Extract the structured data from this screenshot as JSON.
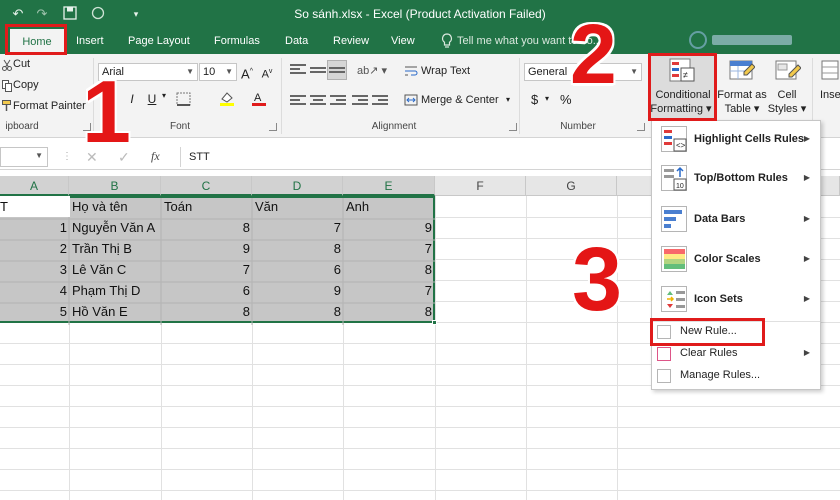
{
  "window": {
    "title": "So sánh.xlsx - Excel (Product Activation Failed)"
  },
  "qat": {
    "undo_icon": "undo-icon",
    "redo_icon": "redo-icon",
    "autosave_icon": "circle-icon",
    "customize_icon": "chevron-down-icon"
  },
  "tabs": [
    "Home",
    "Insert",
    "Page Layout",
    "Formulas",
    "Data",
    "Review",
    "View"
  ],
  "tell_me": "Tell me what you want to do...",
  "clipboard": {
    "cut": "Cut",
    "copy": "Copy",
    "format_painter": "Format Painter",
    "group": "ipboard"
  },
  "font": {
    "name": "Arial",
    "size": "10",
    "bold": "B",
    "italic": "I",
    "underline": "U",
    "group": "Font"
  },
  "alignment": {
    "wrap_text": "Wrap Text",
    "merge_center": "Merge & Center",
    "group": "Alignment"
  },
  "number": {
    "format": "General",
    "currency": "$",
    "percent": "%",
    "group": "Number"
  },
  "styles": {
    "conditional_formatting": [
      "Conditional",
      "Formatting"
    ],
    "format_as_table": [
      "Format as",
      "Table"
    ],
    "cell_styles": [
      "Cell",
      "Styles"
    ],
    "insert": "Inse"
  },
  "formula_bar": {
    "fx": "fx",
    "value": "STT"
  },
  "columns": [
    "A",
    "B",
    "C",
    "D",
    "E",
    "F",
    "G"
  ],
  "sheet": {
    "header_row": [
      "T",
      "Họ và tên",
      "Toán",
      "Văn",
      "Anh"
    ],
    "rows": [
      [
        "1",
        "Nguyễn Văn A",
        "8",
        "7",
        "9"
      ],
      [
        "2",
        "Trần Thị B",
        "9",
        "8",
        "7"
      ],
      [
        "3",
        "Lê Văn C",
        "7",
        "6",
        "8"
      ],
      [
        "4",
        "Phạm Thị D",
        "6",
        "9",
        "7"
      ],
      [
        "5",
        "Hồ Văn E",
        "8",
        "8",
        "8"
      ]
    ]
  },
  "cf_menu": {
    "highlight": "Highlight Cells Rules",
    "topbottom": "Top/Bottom Rules",
    "databars": "Data Bars",
    "colorscales": "Color Scales",
    "iconsets": "Icon Sets",
    "newrule": "New Rule...",
    "clearrules": "Clear Rules",
    "managerules": "Manage Rules..."
  },
  "annotations": {
    "step1": "1",
    "step2": "2",
    "step3": "3"
  },
  "colors": {
    "excel_green": "#217346",
    "annotation_red": "#e01b1b",
    "selection_gray": "#c6c6c6"
  }
}
